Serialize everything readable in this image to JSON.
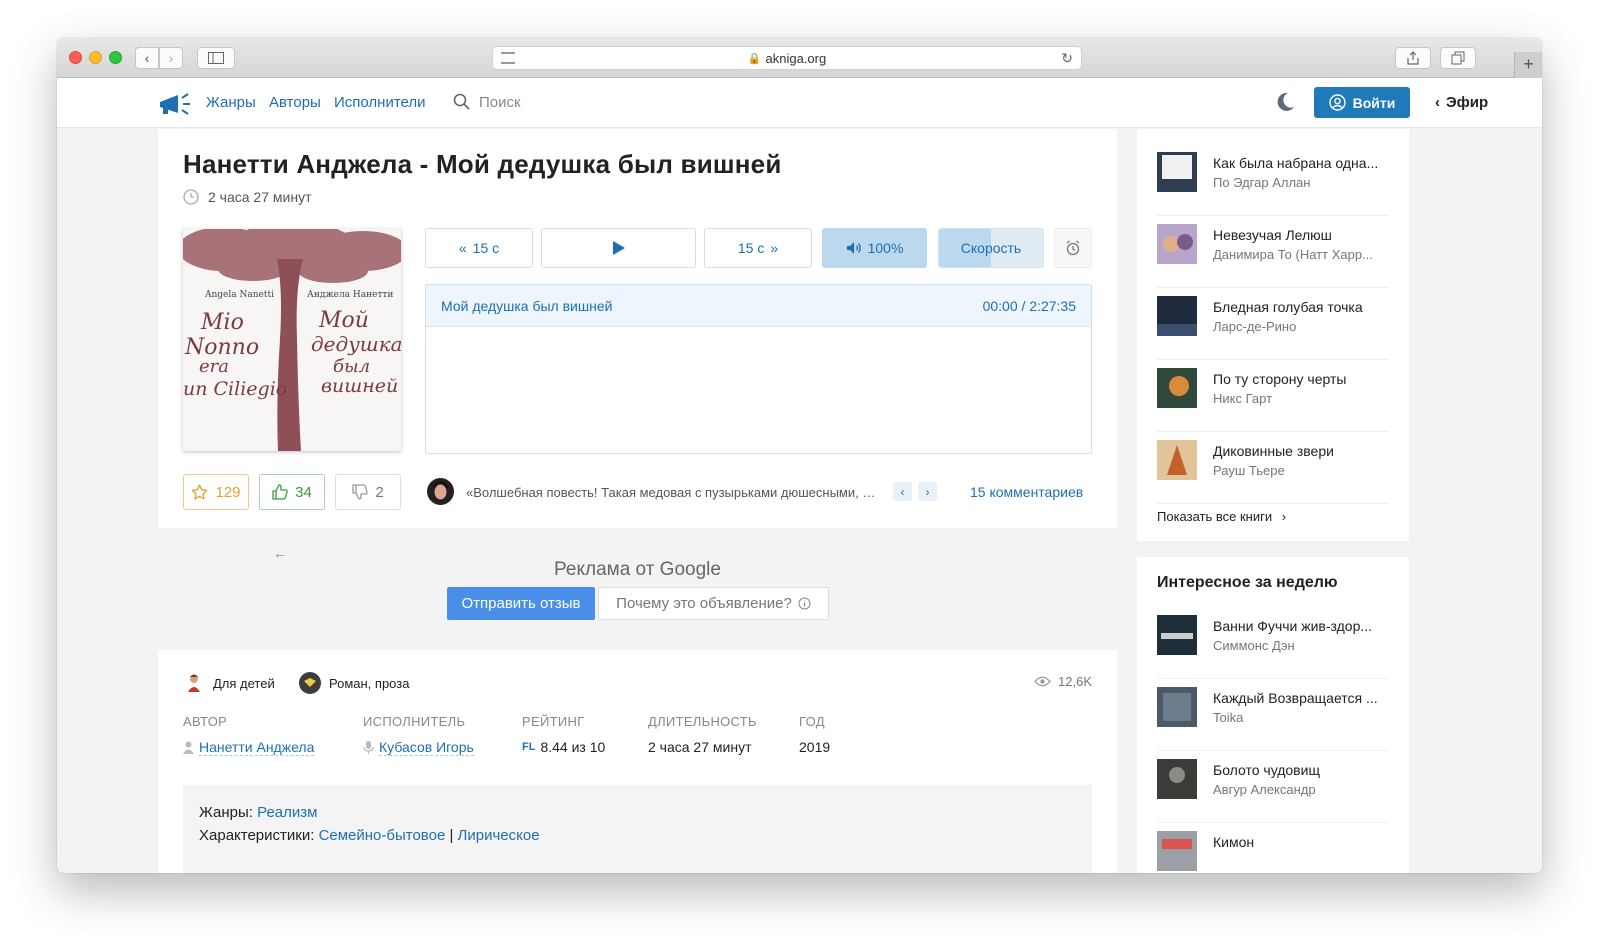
{
  "browser": {
    "url": "akniga.org"
  },
  "nav": {
    "links": [
      "Жанры",
      "Авторы",
      "Исполнители"
    ],
    "search_placeholder": "Поиск",
    "login": "Войти",
    "efir": "Эфир"
  },
  "book": {
    "title": "Нанетти Анджела - Мой дедушка был вишней",
    "duration": "2 часа 27 минут",
    "cover": {
      "author_it": "Angela Nanetti",
      "author_ru": "Анджела Нанетти",
      "title_it": "Mio Nonno era un Ciliegio",
      "title_ru": "Мой дедушка был вишней"
    }
  },
  "player": {
    "back": "15 с",
    "forward": "15 с",
    "volume": "100%",
    "speed": "Скорость",
    "chapter_title": "Мой дедушка был вишней",
    "time": "00:00 / 2:27:35"
  },
  "stats": {
    "favorites": "129",
    "likes": "34",
    "dislikes": "2"
  },
  "comment": {
    "text": "«Волшебная повесть! Такая медовая с пузырьками дюшесными, п...",
    "count_label": "15 комментариев"
  },
  "ad": {
    "title": "Реклама от Google",
    "feedback": "Отправить отзыв",
    "why": "Почему это объявление?"
  },
  "info": {
    "tags": [
      "Для детей",
      "Роман, проза"
    ],
    "views": "12,6K",
    "labels": {
      "author": "АВТОР",
      "performer": "ИСПОЛНИТЕЛЬ",
      "rating": "РЕЙТИНГ",
      "duration": "ДЛИТЕЛЬНОСТЬ",
      "year": "ГОД"
    },
    "author": "Нанетти Анджела",
    "performer": "Кубасов Игорь",
    "rating": "8.44 из 10",
    "duration": "2 часа 27 минут",
    "year": "2019",
    "genres_label": "Жанры:",
    "genre": "Реализм",
    "chars_label": "Характеристики:",
    "chars": [
      "Семейно-бытовое",
      "Лирическое"
    ],
    "chars_sep": "|"
  },
  "sidebar": {
    "recent": [
      {
        "title": "Как была набрана одна...",
        "author": "По Эдгар Аллан"
      },
      {
        "title": "Невезучая Лелюш",
        "author": "Данимира То (Натт Харр..."
      },
      {
        "title": "Бледная голубая точка",
        "author": "Ларс-де-Рино"
      },
      {
        "title": "По ту сторону черты",
        "author": "Никс Гарт"
      },
      {
        "title": "Диковинные звери",
        "author": "Рауш Тьере"
      }
    ],
    "show_all": "Показать все книги",
    "weekly_title": "Интересное за неделю",
    "weekly": [
      {
        "title": "Ванни Фуччи жив-здор...",
        "author": "Симмонс Дэн"
      },
      {
        "title": "Каждый Возвращается ...",
        "author": "Toika"
      },
      {
        "title": "Болото чудовищ",
        "author": "Авгур Александр"
      },
      {
        "title": "Кимон",
        "author": ""
      }
    ]
  },
  "colors": {
    "link": "#1e6fb0",
    "login_bg": "#1e7ab8",
    "favorite": "#e7a02b",
    "like": "#3a9a3a",
    "ad_button": "#4a8ee8"
  }
}
